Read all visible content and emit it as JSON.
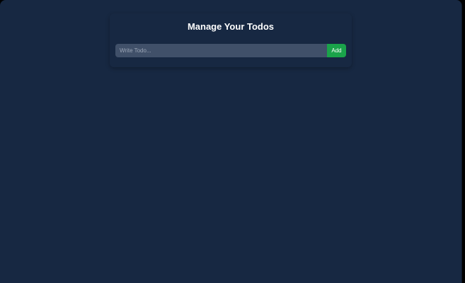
{
  "page": {
    "title": "Manage Your Todos"
  },
  "todo_form": {
    "input_value": "",
    "input_placeholder": "Write Todo...",
    "add_label": "Add"
  },
  "todos": [],
  "colors": {
    "background": "#172842",
    "input_background": "#405069",
    "add_button": "#1aa34a",
    "title_text": "#ffffff"
  }
}
